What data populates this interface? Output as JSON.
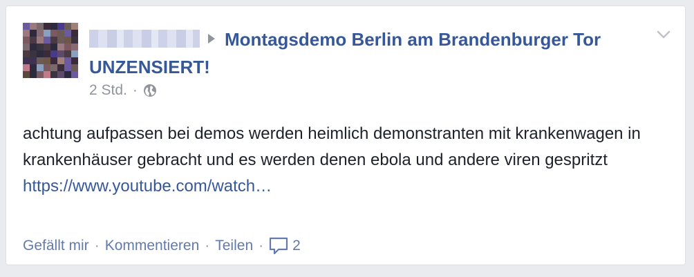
{
  "post": {
    "author_name": "",
    "group_name_line1": "Montagsdemo Berlin am Brandenburger Tor",
    "group_name_line2": "UNZENSIERT!",
    "timestamp": "2 Std.",
    "separator": "·",
    "privacy_icon": "globe-icon",
    "body_text": "achtung aufpassen bei demos werden heimlich demonstranten mit krankenwagen in krankenhäuser gebracht und es werden denen ebola und andere viren gespritzt",
    "link_text": "https://www.youtube.com/watch…"
  },
  "actions": {
    "like_label": "Gefällt mir",
    "comment_label": "Kommentieren",
    "share_label": "Teilen",
    "separator": "·",
    "comment_count": "2",
    "comment_icon": "comment-bubble-icon"
  },
  "menu": {
    "chevron_icon": "chevron-down-icon"
  },
  "colors": {
    "link": "#365899",
    "meta": "#90949c",
    "text": "#1d2129",
    "background": "#e9ebee"
  }
}
